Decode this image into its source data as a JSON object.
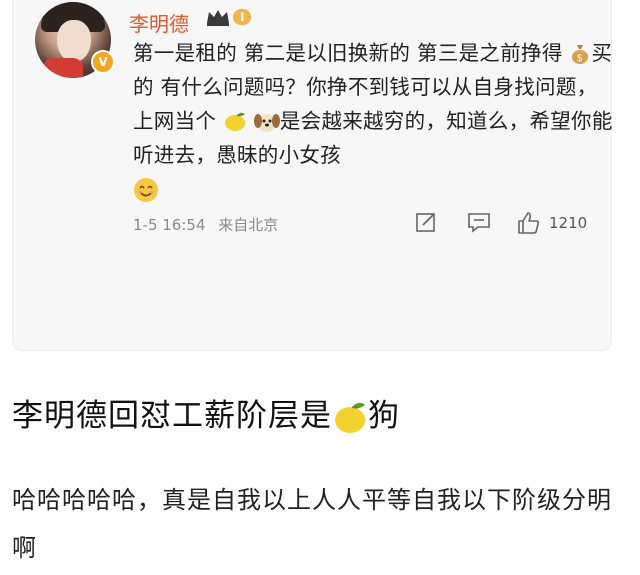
{
  "comment_card": {
    "username": "李明德",
    "level_badge": "I",
    "verified_badge": "V",
    "comment_segments": [
      "第一是租的 第二是以旧换新的 第三是之前挣得",
      "买的 有什么问题吗？你挣不到钱可以从自身找问题，上网当个",
      "是会越来越穷的，知道么，希望你能听进去，愚昧的小女孩"
    ],
    "emoji_icons": [
      "money-bag-icon",
      "lemon-icon",
      "dog-icon",
      "smile-icon"
    ],
    "date": "1-5 16:54",
    "location": "来自北京",
    "like_count": "1210"
  },
  "article": {
    "headline": "李明德回怼工薪阶层是",
    "headline_suffix": "狗",
    "body": "哈哈哈哈哈，真是自我以上人人平等自我以下阶级分明啊"
  },
  "colors": {
    "username": "#e8572d",
    "card_background": "#f7f7f8",
    "badge": "#f3b44b"
  }
}
